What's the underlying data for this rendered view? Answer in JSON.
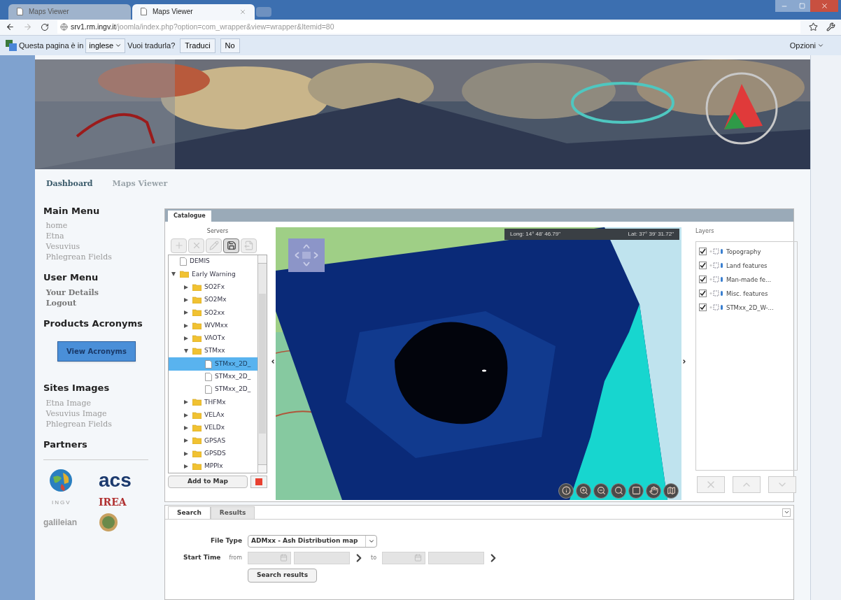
{
  "browser": {
    "tabs": [
      {
        "title": "Maps Viewer",
        "selected": false
      },
      {
        "title": "Maps Viewer",
        "selected": true
      }
    ],
    "url": {
      "host": "srv1.rm.ingv.it",
      "path": "/joomla/index.php?option=com_wrapper&view=wrapper&Itemid=80"
    },
    "translate_bar": {
      "message": "Questa pagina è in",
      "language": "inglese",
      "question": "Vuoi tradurla?",
      "buttons": [
        "Traduci",
        "No"
      ],
      "options": "Opzioni"
    }
  },
  "nav": [
    {
      "label": "Dashboard",
      "selected": true
    },
    {
      "label": "Maps Viewer",
      "selected": false
    }
  ],
  "sidebar": [
    {
      "title": "Main Menu",
      "kind": "links",
      "items": [
        "home",
        "Etna",
        "Vesuvius",
        "Phlegrean Fields"
      ]
    },
    {
      "title": "User Menu",
      "kind": "links",
      "items": [
        "Your Details",
        "Logout"
      ]
    },
    {
      "title": "Products Acronyms",
      "kind": "button",
      "button": "View Acronyms"
    },
    {
      "title": "Sites Images",
      "kind": "links",
      "items": [
        "Etna Image",
        "Vesuvius Image",
        "Phlegrean Fields"
      ]
    },
    {
      "title": "Partners",
      "kind": "logos",
      "logos": [
        "acs",
        "INGV",
        "IREA",
        "galileian"
      ]
    }
  ],
  "catalogue": {
    "tab": "Catalogue",
    "servers": {
      "title": "Servers",
      "tools": [
        {
          "kind": "add",
          "disabled": true
        },
        {
          "kind": "delete",
          "disabled": true
        },
        {
          "kind": "edit",
          "disabled": true
        },
        {
          "kind": "save",
          "disabled": false
        },
        {
          "kind": "export",
          "disabled": true
        }
      ],
      "tree": [
        {
          "label": "DEMIS",
          "kind": "file",
          "selected": false
        },
        {
          "label": "Early Warning",
          "kind": "folder",
          "expanded": true,
          "children": [
            {
              "label": "SO2Fx",
              "kind": "folder",
              "expanded": false
            },
            {
              "label": "SO2Mx",
              "kind": "folder",
              "expanded": false
            },
            {
              "label": "SO2xx",
              "kind": "folder",
              "expanded": false
            },
            {
              "label": "WVMxx",
              "kind": "folder",
              "expanded": false
            },
            {
              "label": "VAOTx",
              "kind": "folder",
              "expanded": false
            },
            {
              "label": "STMxx",
              "kind": "folder",
              "expanded": true,
              "children": [
                {
                  "label": "STMxx_2D_",
                  "kind": "file",
                  "selected": true
                },
                {
                  "label": "STMxx_2D_",
                  "kind": "file",
                  "selected": false
                },
                {
                  "label": "STMxx_2D_",
                  "kind": "file",
                  "selected": false
                }
              ]
            },
            {
              "label": "THFMx",
              "kind": "folder",
              "expanded": false
            },
            {
              "label": "VELAx",
              "kind": "folder",
              "expanded": false
            },
            {
              "label": "VELDx",
              "kind": "folder",
              "expanded": false
            },
            {
              "label": "GPSAS",
              "kind": "folder",
              "expanded": false
            },
            {
              "label": "GPSDS",
              "kind": "folder",
              "expanded": false
            },
            {
              "label": "MPPIx",
              "kind": "folder",
              "expanded": false
            }
          ]
        }
      ],
      "add_button": "Add to Map"
    },
    "map": {
      "longitude": "Long: 14° 48' 46.79\"",
      "latitude": "Lat: 37° 39' 31.72\""
    },
    "layers": {
      "title": "Layers",
      "items": [
        {
          "name": "Topography",
          "checked": true
        },
        {
          "name": "Land features",
          "checked": true
        },
        {
          "name": "Man-made fe...",
          "checked": true
        },
        {
          "name": "Misc. features",
          "checked": true
        },
        {
          "name": "STMxx_2D_W-...",
          "checked": true
        }
      ],
      "buttons": [
        {
          "kind": "remove",
          "disabled": true
        },
        {
          "kind": "up",
          "disabled": true
        },
        {
          "kind": "down",
          "disabled": true
        }
      ]
    }
  },
  "search_panel": {
    "tabs": [
      {
        "label": "Search",
        "selected": true
      },
      {
        "label": "Results",
        "selected": false
      }
    ],
    "file_type_label": "File Type",
    "file_type": "ADMxx - Ash Distribution map",
    "start_time_label": "Start Time",
    "from_label": "from",
    "to_label": "to",
    "button": "Search results"
  }
}
